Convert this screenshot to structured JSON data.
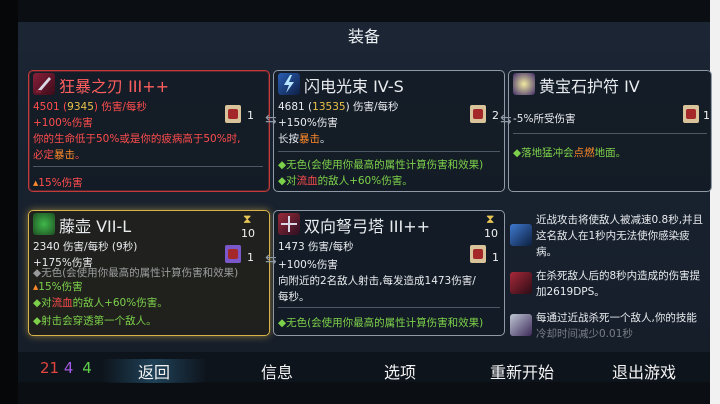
{
  "header": {
    "title": "装备"
  },
  "cards": {
    "c1": {
      "title": "狂暴之刃 III++",
      "stat_base": "4501 (",
      "stat_bonus": "9345",
      "stat_tail": ") 伤害/每秒",
      "count": "1",
      "l1": "+100%伤害",
      "l2": "你的生命低于50%或是你的疲病高于50%时,",
      "l3a": "必定",
      "l3b": "暴击",
      "l3c": "。",
      "l4": "15%伤害"
    },
    "c2": {
      "title": "闪电光束 IV-S",
      "stat_base": "4681 (",
      "stat_bonus": "13535",
      "stat_tail": ") 伤害/每秒",
      "count": "2",
      "l1": "+150%伤害",
      "l2a": "长按",
      "l2b": "暴击",
      "l2c": "。",
      "l3": "无色(会使用你最高的属性计算伤害和效果)",
      "l4a": "对",
      "l4b": "流血",
      "l4c": "的敌人+60%伤害。"
    },
    "c3": {
      "title": "黄宝石护符 IV",
      "count": "1",
      "l1": "-5%所受伤害",
      "l2a": "落地猛冲会",
      "l2b": "点燃",
      "l2c": "地面。"
    },
    "c4": {
      "title": "藤壶 VII-L",
      "hour": "10",
      "stat": "2340 伤害/每秒 (9秒)",
      "count": "1",
      "l1": "+175%伤害",
      "l2": "无色(会使用你最高的属性计算伤害和效果)",
      "l3": "15%伤害",
      "l4a": "对",
      "l4b": "流血",
      "l4c": "的敌人+60%伤害。",
      "l5": "射击会穿透第一个敌人。"
    },
    "c5": {
      "title": "双向弩弓塔 III++",
      "hour": "10",
      "stat": "1473 伤害/每秒",
      "count": "1",
      "l1": "+100%伤害",
      "l2": "向附近的2名敌人射击,每发造成1473伤害/",
      "l3": "每秒。",
      "l4": "无色(会使用你最高的属性计算伤害和效果)"
    },
    "c6": {
      "a1": "近战攻击将使敌人被减速0.8秒,并且",
      "a2": "这名敌人在1秒内无法使你感染疲",
      "a3": "病。",
      "b1": "在杀死敌人后的8秒内造成的伤害提",
      "b2": "加2619DPS。",
      "c1": "每通过近战杀死一个敌人,你的技能",
      "c2": "冷却时间减少0.01秒"
    }
  },
  "bottom": {
    "s1": "21",
    "s2": "4",
    "s3": "4",
    "back": "返回",
    "info": "信息",
    "options": "选项",
    "restart": "重新开始",
    "quit": "退出游戏"
  },
  "colors": {
    "brutality": "#e0453f",
    "tactics": "#a35ae6",
    "survival": "#5fcf4a"
  }
}
